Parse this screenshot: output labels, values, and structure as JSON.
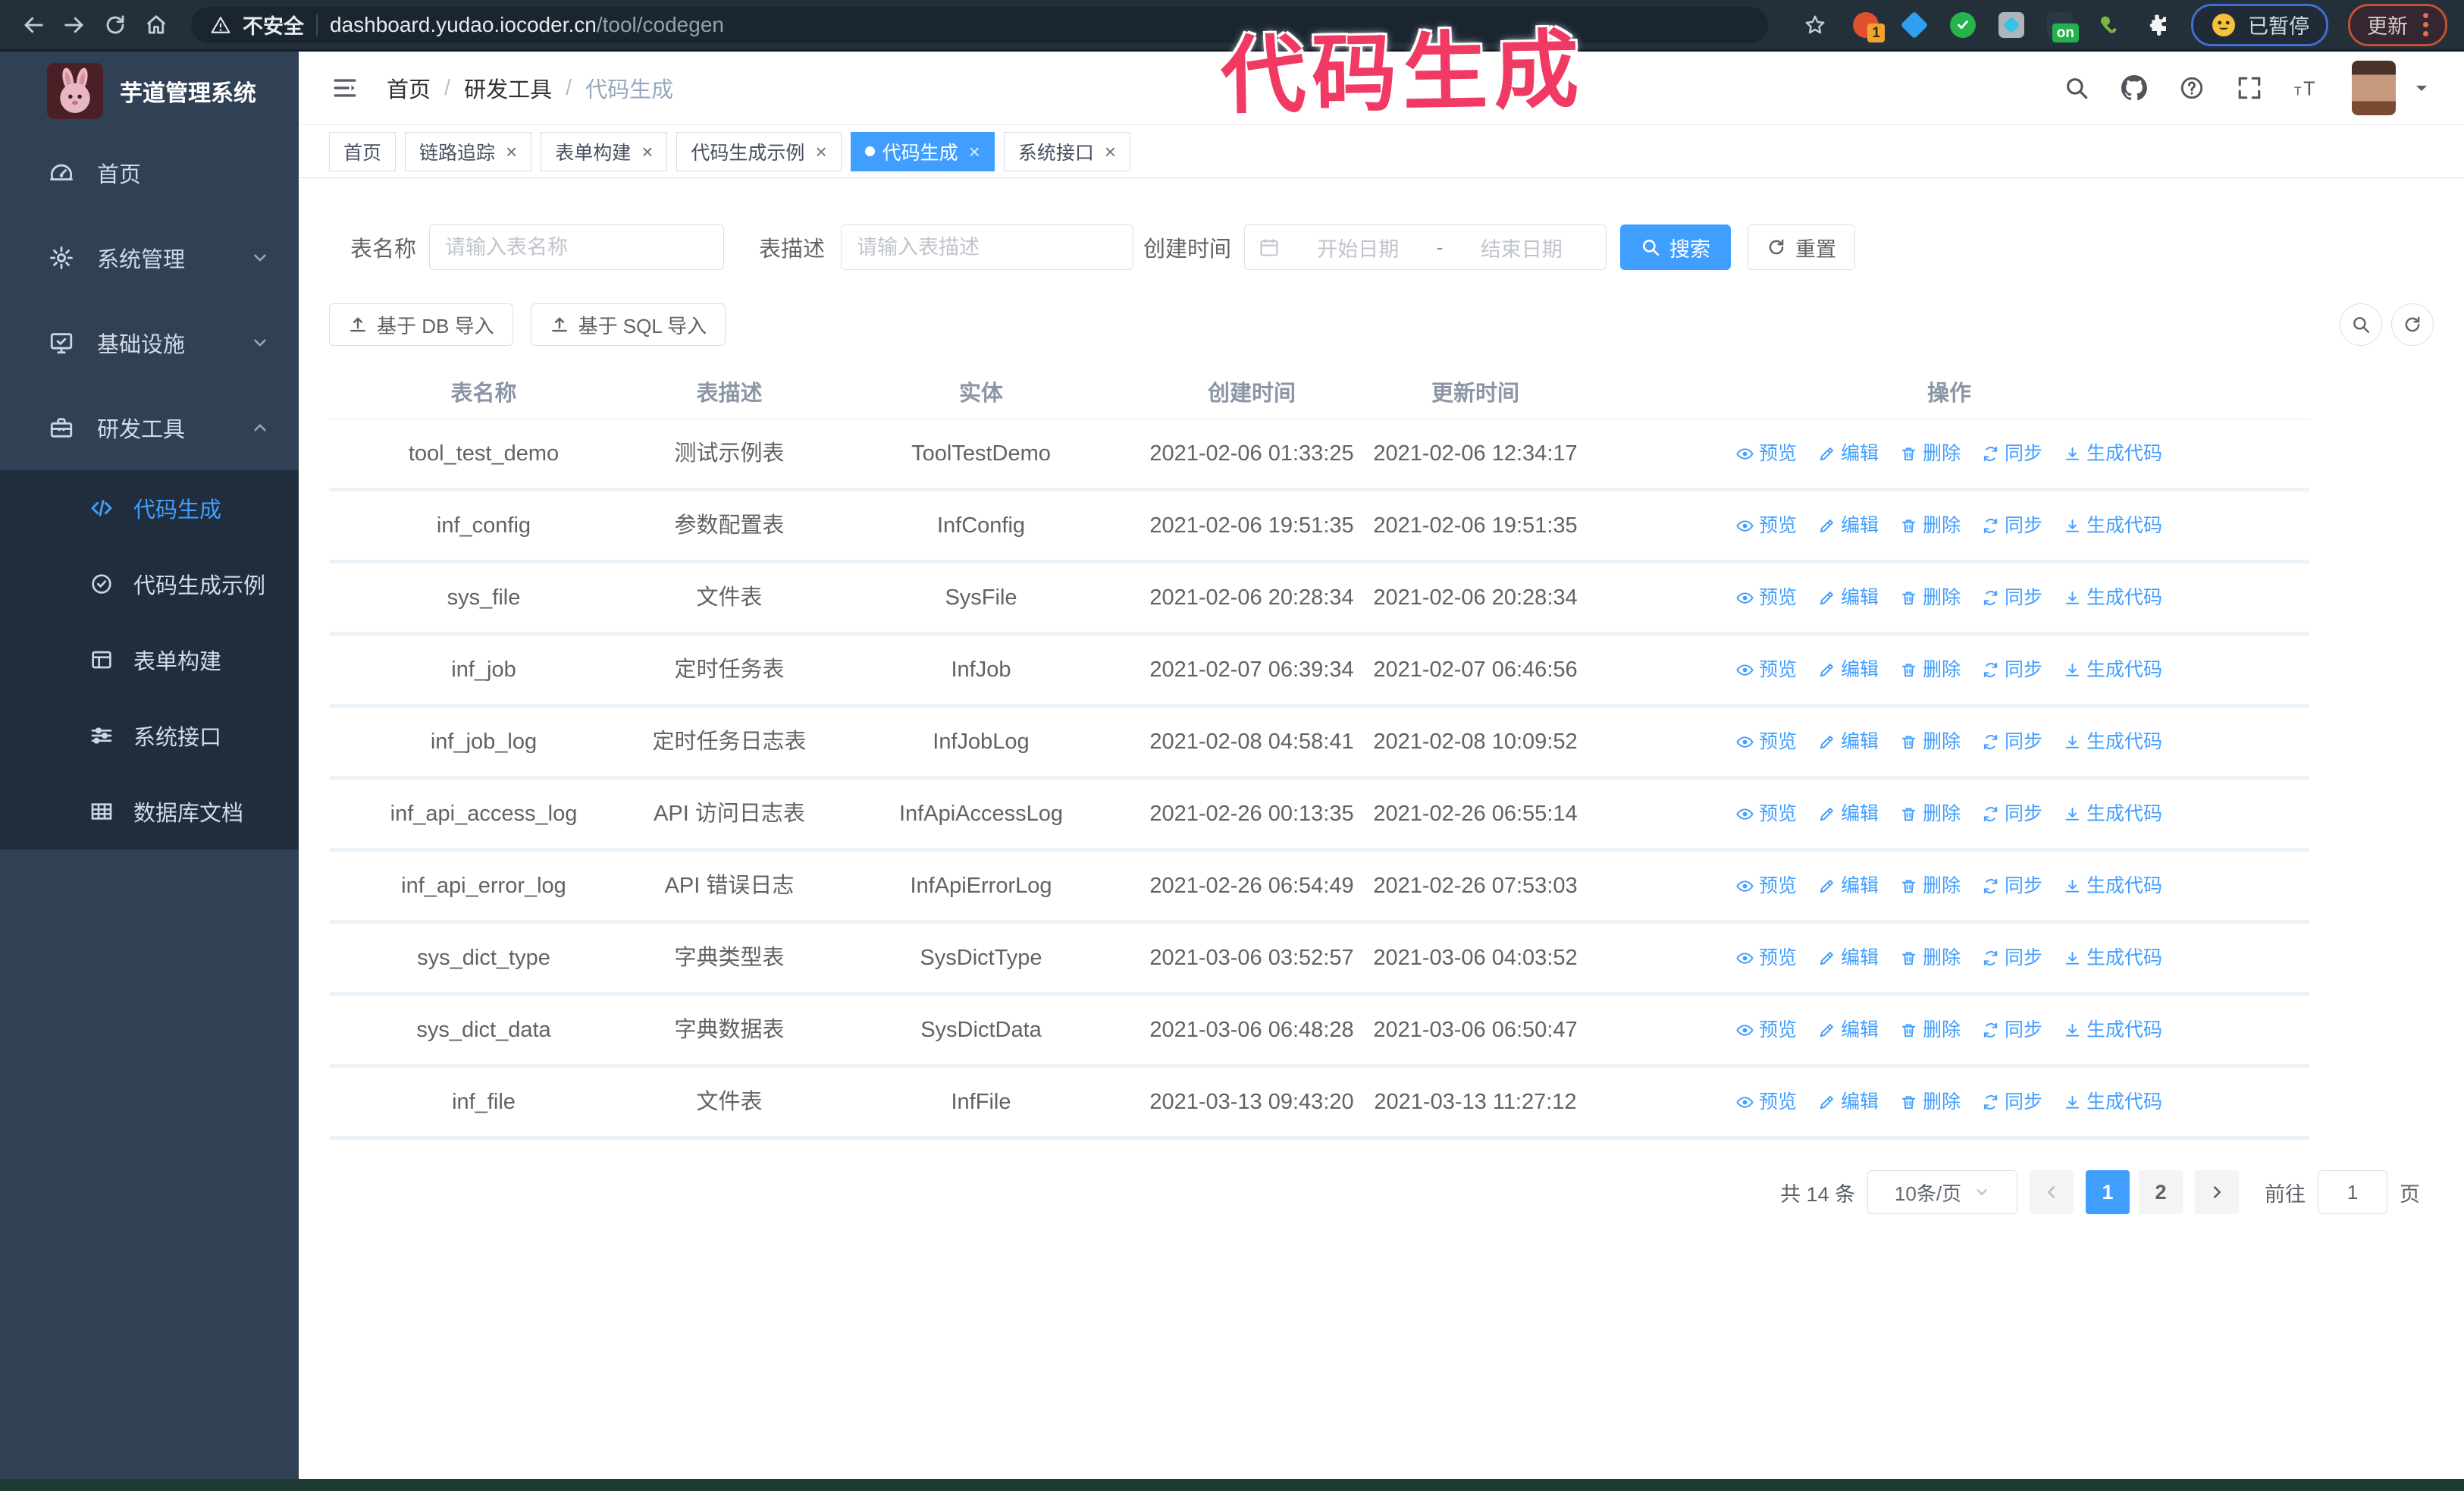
{
  "browser": {
    "security_label": "不安全",
    "url_host": "dashboard.yudao.iocoder.cn",
    "url_path": "/tool/codegen",
    "paused_label": "已暂停",
    "update_label": "更新",
    "ext_badge": "1",
    "ext_on_badge": "on"
  },
  "annotation": {
    "text": "代码生成",
    "color": "#f03a64"
  },
  "colors": {
    "accent": "#409eff",
    "sidebar": "#304156",
    "submenu": "#1f2d3d"
  },
  "sidebar": {
    "app_title": "芋道管理系统",
    "items": [
      {
        "label": "首页",
        "icon": "dashboard-icon",
        "chevron": ""
      },
      {
        "label": "系统管理",
        "icon": "gear-icon",
        "chevron": "down"
      },
      {
        "label": "基础设施",
        "icon": "monitor-icon",
        "chevron": "down"
      },
      {
        "label": "研发工具",
        "icon": "toolbox-icon",
        "chevron": "up"
      }
    ],
    "submenu": [
      {
        "label": "代码生成",
        "icon": "code-icon",
        "active": true
      },
      {
        "label": "代码生成示例",
        "icon": "badge-check-icon",
        "active": false
      },
      {
        "label": "表单构建",
        "icon": "form-icon",
        "active": false
      },
      {
        "label": "系统接口",
        "icon": "sliders-icon",
        "active": false
      },
      {
        "label": "数据库文档",
        "icon": "db-grid-icon",
        "active": false
      }
    ]
  },
  "header": {
    "breadcrumb": [
      "首页",
      "研发工具",
      "代码生成"
    ],
    "icons": [
      "search-icon",
      "github-icon",
      "question-icon",
      "fullscreen-icon",
      "font-size-icon"
    ]
  },
  "tabs": [
    {
      "label": "首页",
      "closable": false,
      "active": false
    },
    {
      "label": "链路追踪",
      "closable": true,
      "active": false
    },
    {
      "label": "表单构建",
      "closable": true,
      "active": false
    },
    {
      "label": "代码生成示例",
      "closable": true,
      "active": false
    },
    {
      "label": "代码生成",
      "closable": true,
      "active": true
    },
    {
      "label": "系统接口",
      "closable": true,
      "active": false
    }
  ],
  "filters": {
    "name_label": "表名称",
    "name_placeholder": "请输入表名称",
    "desc_label": "表描述",
    "desc_placeholder": "请输入表描述",
    "time_label": "创建时间",
    "start_placeholder": "开始日期",
    "separator": "-",
    "end_placeholder": "结束日期",
    "search_label": "搜索",
    "reset_label": "重置"
  },
  "toolbar": {
    "import_db_label": "基于 DB 导入",
    "import_sql_label": "基于 SQL 导入"
  },
  "table": {
    "columns": [
      "表名称",
      "表描述",
      "实体",
      "创建时间",
      "更新时间",
      "操作"
    ],
    "actions": [
      {
        "label": "预览",
        "icon": "eye-icon"
      },
      {
        "label": "编辑",
        "icon": "edit-icon"
      },
      {
        "label": "删除",
        "icon": "trash-icon"
      },
      {
        "label": "同步",
        "icon": "sync-icon"
      },
      {
        "label": "生成代码",
        "icon": "download-icon"
      }
    ],
    "rows": [
      {
        "name": "tool_test_demo",
        "desc": "测试示例表",
        "entity": "ToolTestDemo",
        "created": "2021-02-06 01:33:25",
        "updated": "2021-02-06 12:34:17"
      },
      {
        "name": "inf_config",
        "desc": "参数配置表",
        "entity": "InfConfig",
        "created": "2021-02-06 19:51:35",
        "updated": "2021-02-06 19:51:35"
      },
      {
        "name": "sys_file",
        "desc": "文件表",
        "entity": "SysFile",
        "created": "2021-02-06 20:28:34",
        "updated": "2021-02-06 20:28:34"
      },
      {
        "name": "inf_job",
        "desc": "定时任务表",
        "entity": "InfJob",
        "created": "2021-02-07 06:39:34",
        "updated": "2021-02-07 06:46:56"
      },
      {
        "name": "inf_job_log",
        "desc": "定时任务日志表",
        "entity": "InfJobLog",
        "created": "2021-02-08 04:58:41",
        "updated": "2021-02-08 10:09:52"
      },
      {
        "name": "inf_api_access_log",
        "desc": "API 访问日志表",
        "entity": "InfApiAccessLog",
        "created": "2021-02-26 00:13:35",
        "updated": "2021-02-26 06:55:14"
      },
      {
        "name": "inf_api_error_log",
        "desc": "API 错误日志",
        "entity": "InfApiErrorLog",
        "created": "2021-02-26 06:54:49",
        "updated": "2021-02-26 07:53:03"
      },
      {
        "name": "sys_dict_type",
        "desc": "字典类型表",
        "entity": "SysDictType",
        "created": "2021-03-06 03:52:57",
        "updated": "2021-03-06 04:03:52"
      },
      {
        "name": "sys_dict_data",
        "desc": "字典数据表",
        "entity": "SysDictData",
        "created": "2021-03-06 06:48:28",
        "updated": "2021-03-06 06:50:47"
      },
      {
        "name": "inf_file",
        "desc": "文件表",
        "entity": "InfFile",
        "created": "2021-03-13 09:43:20",
        "updated": "2021-03-13 11:27:12"
      }
    ]
  },
  "pagination": {
    "total": "共 14 条",
    "page_size": "10条/页",
    "pages": [
      "1",
      "2"
    ],
    "active_page": "1",
    "goto_label": "前往",
    "goto_value": "1",
    "page_unit": "页"
  }
}
